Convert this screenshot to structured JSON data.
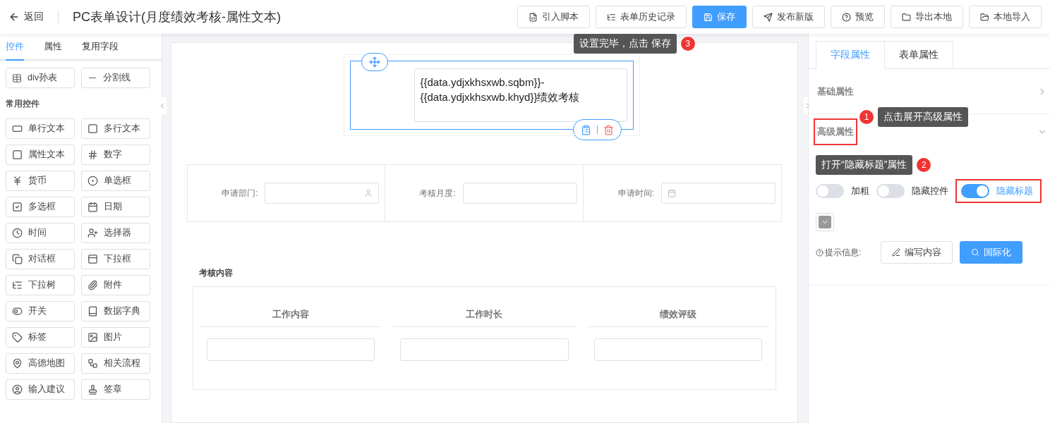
{
  "header": {
    "back_label": "返回",
    "title": "PC表单设计(月度绩效考核-属性文本)",
    "buttons": [
      {
        "label": "引入脚本",
        "kind": "default"
      },
      {
        "label": "表单历史记录",
        "kind": "default"
      },
      {
        "label": "保存",
        "kind": "primary"
      },
      {
        "label": "发布新版",
        "kind": "default"
      },
      {
        "label": "预览",
        "kind": "default"
      },
      {
        "label": "导出本地",
        "kind": "default"
      },
      {
        "label": "本地导入",
        "kind": "default"
      }
    ],
    "callout": {
      "step": "3",
      "text": "设置完毕，点击 保存"
    }
  },
  "left_panel": {
    "tabs": [
      {
        "label": "控件",
        "selected": true
      },
      {
        "label": "属性",
        "selected": false
      },
      {
        "label": "复用字段",
        "selected": false
      }
    ],
    "top_items": [
      "div孙表",
      "分割线"
    ],
    "section_title": "常用控件",
    "items": [
      "单行文本",
      "多行文本",
      "属性文本",
      "数字",
      "货币",
      "单选框",
      "多选框",
      "日期",
      "时间",
      "选择器",
      "对话框",
      "下拉框",
      "下拉树",
      "附件",
      "开关",
      "数据字典",
      "标签",
      "图片",
      "高德地图",
      "相关流程",
      "输入建议",
      "签章"
    ]
  },
  "canvas": {
    "title_text": "{{data.ydjxkhsxwb.sqbm}}-{{data.ydjxkhsxwb.khyd}}绩效考核",
    "fields": [
      {
        "label": "申请部门:",
        "kind": "user"
      },
      {
        "label": "考核月度:",
        "kind": "text"
      },
      {
        "label": "申请时间:",
        "kind": "date"
      }
    ],
    "subtable": {
      "title": "考核内容",
      "columns": [
        "工作内容",
        "工作时长",
        "绩效评级"
      ]
    }
  },
  "right_panel": {
    "tabs": [
      {
        "label": "字段属性",
        "selected": true
      },
      {
        "label": "表单属性",
        "selected": false
      }
    ],
    "sections": [
      {
        "title": "基础属性",
        "expanded": false,
        "highlighted": false
      },
      {
        "title": "高级属性",
        "expanded": true,
        "highlighted": true
      }
    ],
    "callouts": [
      {
        "step": "1",
        "text": "点击展开高级属性"
      },
      {
        "step": "2",
        "text": "打开“隐藏标题”属性"
      }
    ],
    "switches": [
      {
        "label": "加粗",
        "on": false,
        "highlighted": false
      },
      {
        "label": "隐藏控件",
        "on": false,
        "highlighted": false
      },
      {
        "label": "隐藏标题",
        "on": true,
        "highlighted": true
      }
    ],
    "hint_label": "提示信息:",
    "buttons": [
      {
        "label": "编写内容",
        "kind": "default"
      },
      {
        "label": "国际化",
        "kind": "primary"
      }
    ]
  }
}
